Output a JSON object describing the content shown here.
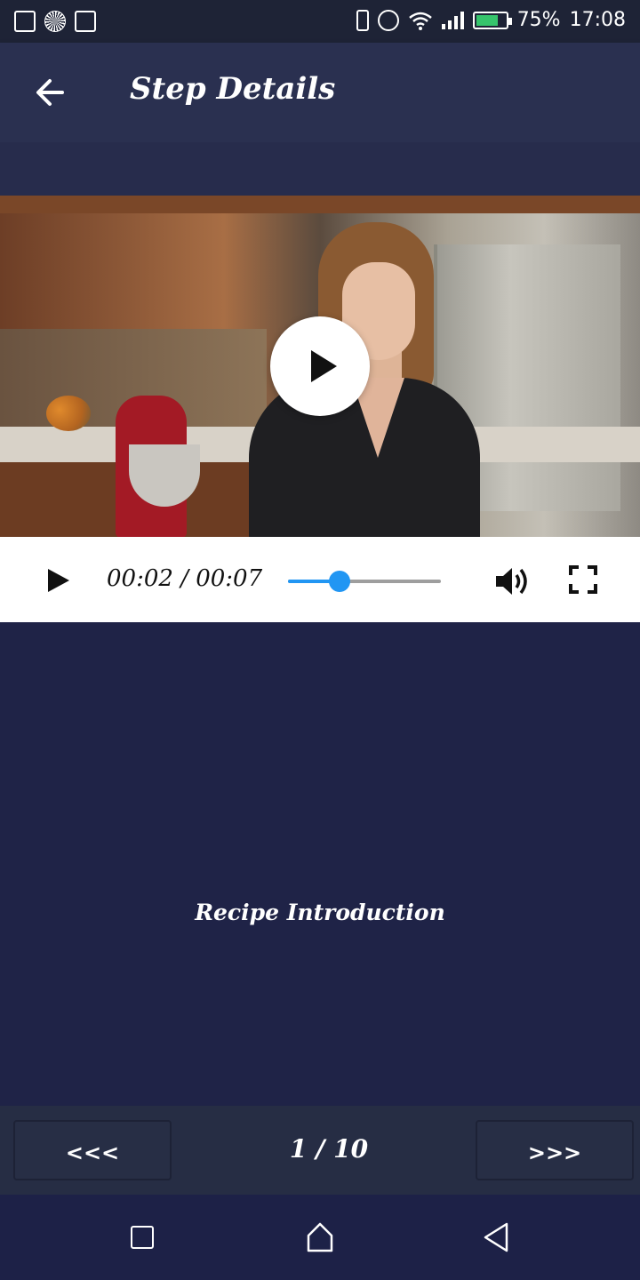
{
  "status_bar": {
    "battery_percent": "75%",
    "time": "17:08",
    "icons": [
      "gallery-icon",
      "app-icon",
      "activity-icon",
      "vibrate-icon",
      "alarm-icon",
      "wifi-icon",
      "signal-icon",
      "battery-charging-icon"
    ]
  },
  "app_bar": {
    "title": "Step Details",
    "back_icon": "arrow-left-icon"
  },
  "video": {
    "overlay_icon": "play-icon",
    "time_display": "00:02 / 00:07",
    "progress": 0.34,
    "volume_icon": "volume-icon",
    "fullscreen_icon": "fullscreen-icon",
    "accent_color": "#2196f3"
  },
  "step": {
    "description": "Recipe Introduction",
    "counter": "1 / 10",
    "prev_label": "<<<",
    "next_label": ">>>"
  },
  "system_nav": {
    "icons": [
      "recents-icon",
      "home-icon",
      "back-icon"
    ]
  },
  "colors": {
    "background": "#1f2347",
    "app_bar": "#2a3050",
    "status_bar": "#1e2336"
  }
}
